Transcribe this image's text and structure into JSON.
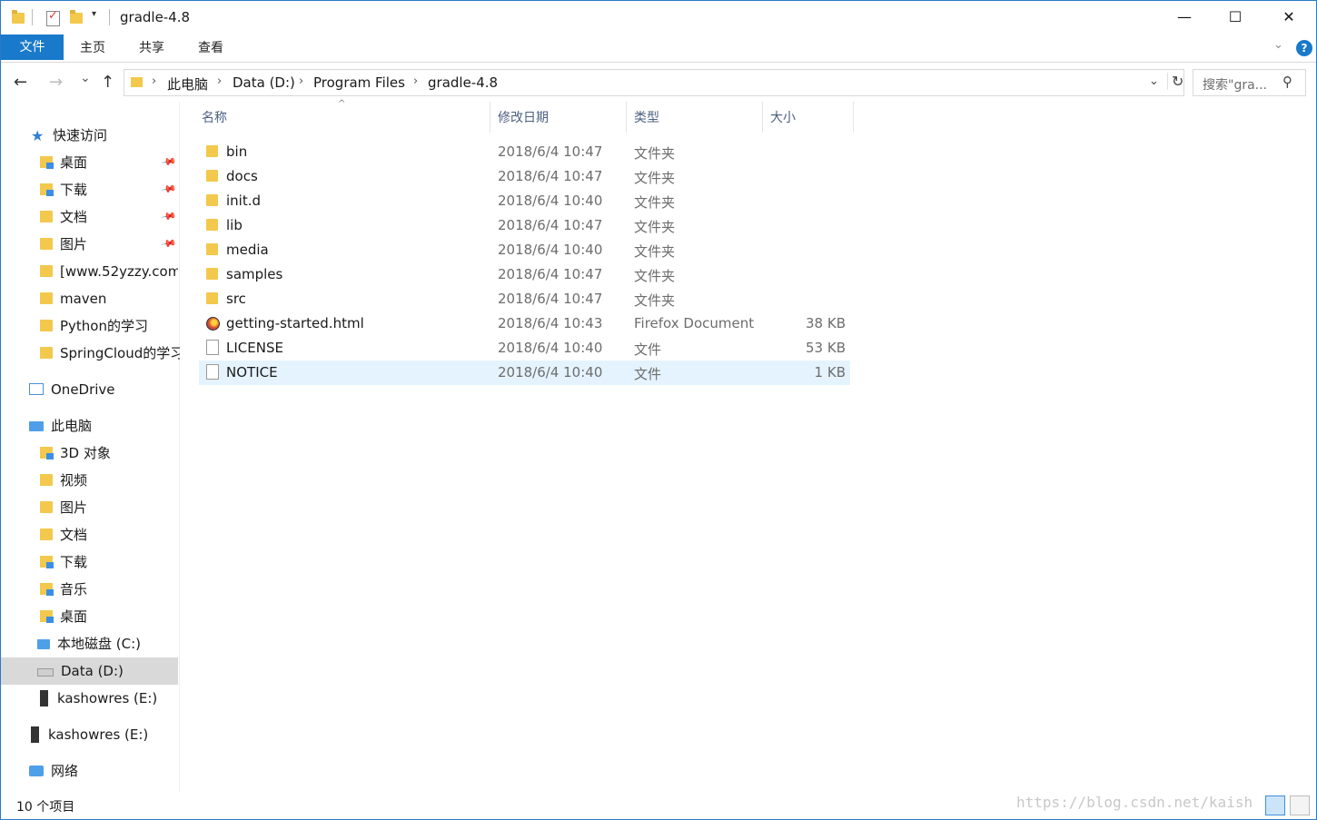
{
  "window": {
    "title": "gradle-4.8",
    "minimize": "—",
    "maximize": "☐",
    "close": "✕"
  },
  "ribbon": {
    "tabs": [
      "文件",
      "主页",
      "共享",
      "查看"
    ],
    "help": "?"
  },
  "nav": {
    "back": "←",
    "forward": "→",
    "recent": "⌄",
    "up": "↑",
    "breadcrumbs": [
      "此电脑",
      "Data (D:)",
      "Program Files",
      "gradle-4.8"
    ],
    "search_placeholder": "搜索\"gra..."
  },
  "sidebar": {
    "quick_access": "快速访问",
    "quick_items": [
      "桌面",
      "下载",
      "文档",
      "图片",
      "[www.52yzzy.com",
      "maven",
      "Python的学习",
      "SpringCloud的学习"
    ],
    "onedrive": "OneDrive",
    "this_pc": "此电脑",
    "pc_items": [
      "3D 对象",
      "视频",
      "图片",
      "文档",
      "下载",
      "音乐",
      "桌面",
      "本地磁盘 (C:)",
      "Data (D:)",
      "kashowres (E:)"
    ],
    "removable": "kashowres (E:)",
    "network": "网络"
  },
  "columns": {
    "name": "名称",
    "modified": "修改日期",
    "type": "类型",
    "size": "大小"
  },
  "files": [
    {
      "name": "bin",
      "modified": "2018/6/4 10:47",
      "type": "文件夹",
      "size": "",
      "icon": "folder-icon"
    },
    {
      "name": "docs",
      "modified": "2018/6/4 10:47",
      "type": "文件夹",
      "size": "",
      "icon": "folder-icon"
    },
    {
      "name": "init.d",
      "modified": "2018/6/4 10:40",
      "type": "文件夹",
      "size": "",
      "icon": "folder-icon"
    },
    {
      "name": "lib",
      "modified": "2018/6/4 10:47",
      "type": "文件夹",
      "size": "",
      "icon": "folder-icon"
    },
    {
      "name": "media",
      "modified": "2018/6/4 10:40",
      "type": "文件夹",
      "size": "",
      "icon": "folder-icon"
    },
    {
      "name": "samples",
      "modified": "2018/6/4 10:47",
      "type": "文件夹",
      "size": "",
      "icon": "folder-icon"
    },
    {
      "name": "src",
      "modified": "2018/6/4 10:47",
      "type": "文件夹",
      "size": "",
      "icon": "folder-icon"
    },
    {
      "name": "getting-started.html",
      "modified": "2018/6/4 10:43",
      "type": "Firefox Document",
      "size": "38 KB",
      "icon": "firefox-icon"
    },
    {
      "name": "LICENSE",
      "modified": "2018/6/4 10:40",
      "type": "文件",
      "size": "53 KB",
      "icon": "file-icon"
    },
    {
      "name": "NOTICE",
      "modified": "2018/6/4 10:40",
      "type": "文件",
      "size": "1 KB",
      "icon": "file-icon"
    }
  ],
  "status": {
    "count": "10 个项目",
    "watermark": "https://blog.csdn.net/kaish"
  },
  "colors": {
    "accent": "#1979ca",
    "selection": "#e5f3ff",
    "folder": "#f2c94c"
  }
}
